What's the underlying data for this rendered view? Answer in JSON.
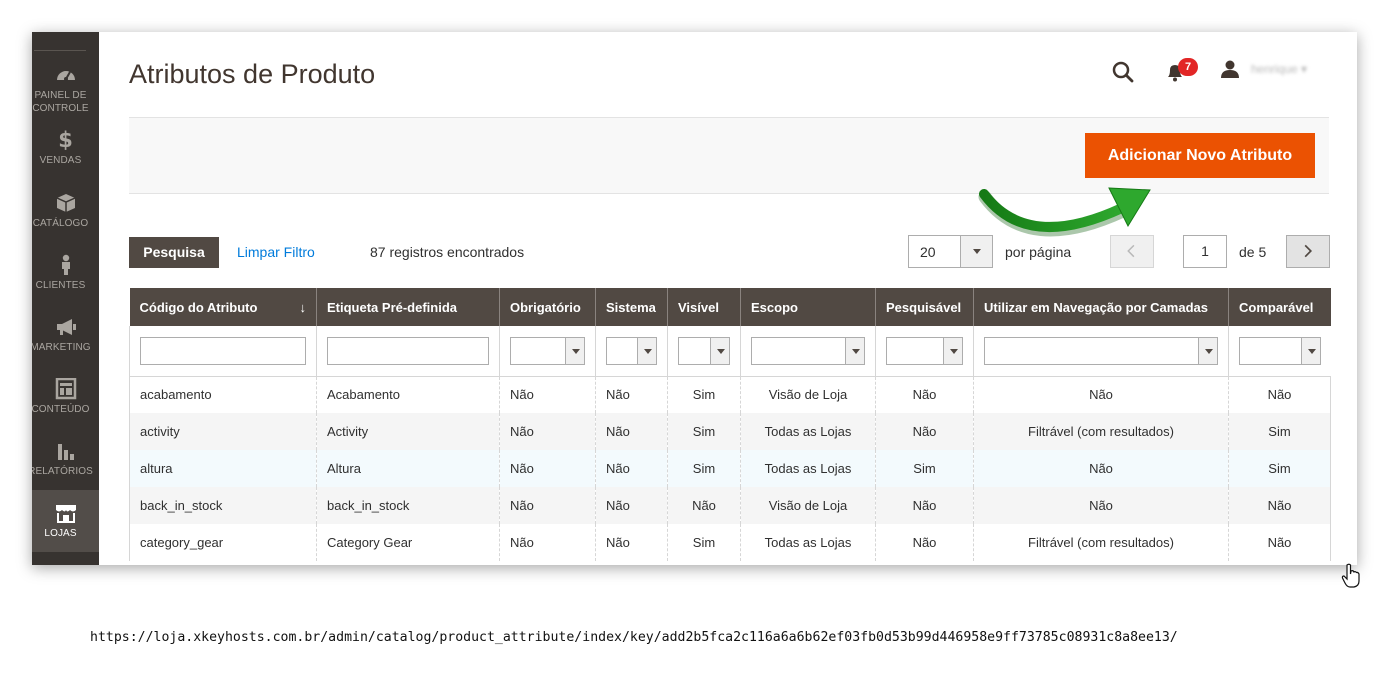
{
  "sidebar": {
    "items": [
      {
        "label": "PAINEL DE CONTROLE",
        "icon": "dashboard-icon"
      },
      {
        "label": "VENDAS",
        "icon": "dollar-icon"
      },
      {
        "label": "CATÁLOGO",
        "icon": "box-icon"
      },
      {
        "label": "CLIENTES",
        "icon": "person-icon"
      },
      {
        "label": "MARKETING",
        "icon": "megaphone-icon"
      },
      {
        "label": "CONTEÚDO",
        "icon": "layout-icon"
      },
      {
        "label": "RELATÓRIOS",
        "icon": "bar-chart-icon"
      },
      {
        "label": "LOJAS",
        "icon": "store-icon"
      }
    ],
    "active_index": 7
  },
  "header": {
    "title": "Atributos de Produto",
    "notification_count": "7",
    "username": "henrique"
  },
  "actions": {
    "add_button": "Adicionar Novo Atributo"
  },
  "toolbar": {
    "search_button": "Pesquisa",
    "reset_filter": "Limpar Filtro",
    "records_found": "87 registros encontrados",
    "per_page_value": "20",
    "per_page_label": "por página",
    "current_page": "1",
    "page_of": "de 5"
  },
  "grid": {
    "columns": [
      "Código do Atributo",
      "Etiqueta Pré-definida",
      "Obrigatório",
      "Sistema",
      "Visível",
      "Escopo",
      "Pesquisável",
      "Utilizar em Navegação por Camadas",
      "Comparável"
    ],
    "sort_indicator": "↓",
    "rows": [
      [
        "acabamento",
        "Acabamento",
        "Não",
        "Não",
        "Sim",
        "Visão de Loja",
        "Não",
        "Não",
        "Não"
      ],
      [
        "activity",
        "Activity",
        "Não",
        "Não",
        "Sim",
        "Todas as Lojas",
        "Não",
        "Filtrável (com resultados)",
        "Sim"
      ],
      [
        "altura",
        "Altura",
        "Não",
        "Não",
        "Sim",
        "Todas as Lojas",
        "Sim",
        "Não",
        "Sim"
      ],
      [
        "back_in_stock",
        "back_in_stock",
        "Não",
        "Não",
        "Não",
        "Visão de Loja",
        "Não",
        "Não",
        "Não"
      ],
      [
        "category_gear",
        "Category Gear",
        "Não",
        "Não",
        "Sim",
        "Todas as Lojas",
        "Não",
        "Filtrável (com resultados)",
        "Não"
      ]
    ]
  },
  "browser": {
    "url": "https://loja.xkeyhosts.com.br/admin/catalog/product_attribute/index/key/add2b5fca2c116a6a6b62ef03fb0d53b99d446958e9ff73785c08931c8a8ee13/"
  },
  "colors": {
    "accent": "#eb5202",
    "sidebar": "#373330",
    "table_header": "#514943",
    "link": "#007bdb",
    "badge": "#e22626",
    "annotation_arrow": "#1e8b1e"
  }
}
